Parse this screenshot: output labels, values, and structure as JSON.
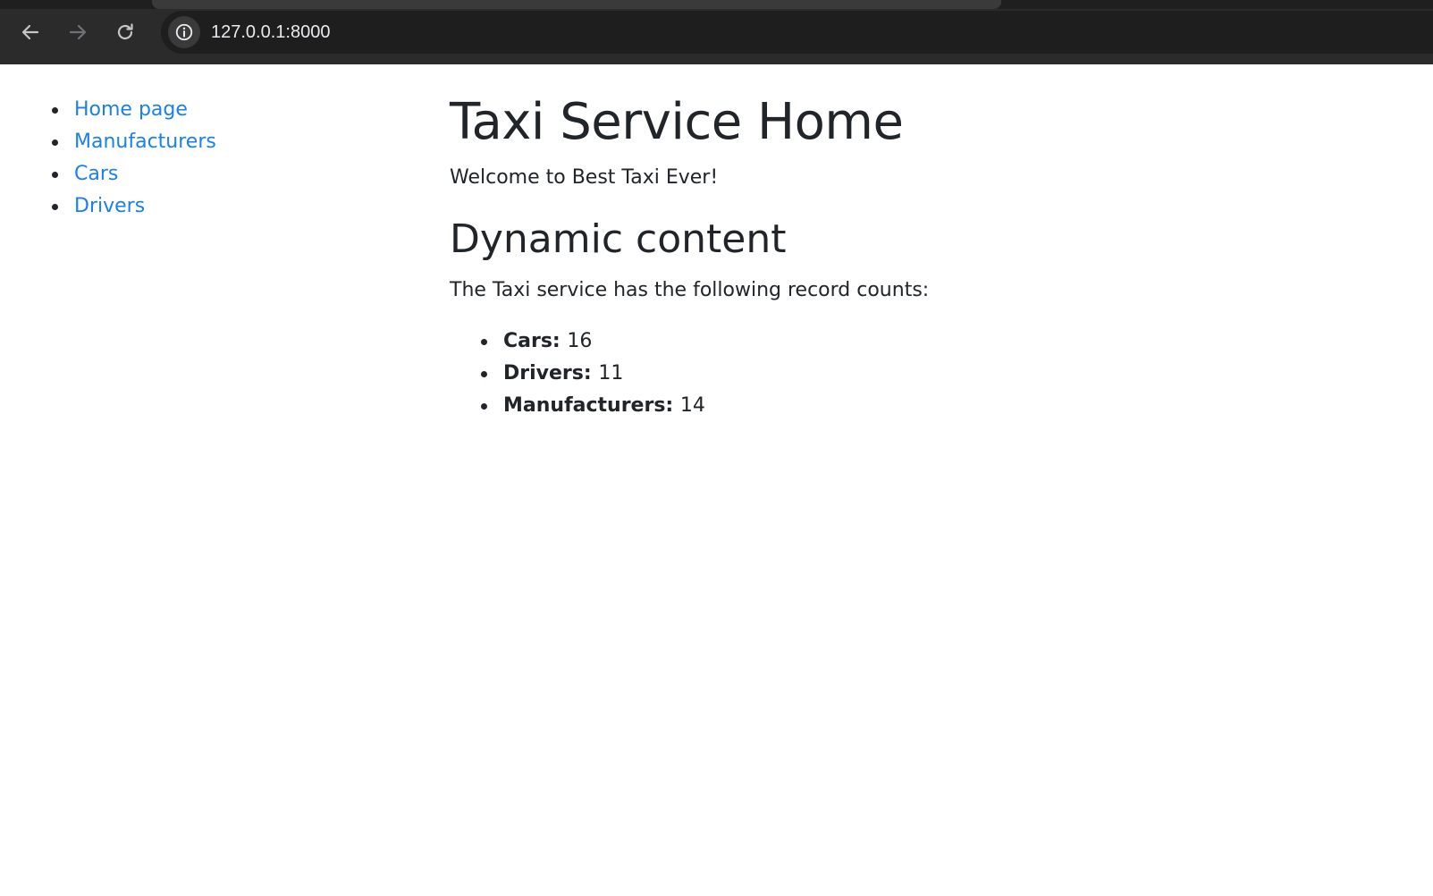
{
  "browser": {
    "url": "127.0.0.1:8000",
    "back_icon": "arrow-left-icon",
    "forward_icon": "arrow-right-icon",
    "reload_icon": "reload-icon",
    "site_info_icon": "info-icon",
    "chrome_color": "#2b2b2b",
    "omnibox_color": "#1e1e1e"
  },
  "sidebar": {
    "items": [
      {
        "label": "Home page"
      },
      {
        "label": "Manufacturers"
      },
      {
        "label": "Cars"
      },
      {
        "label": "Drivers"
      }
    ],
    "link_color": "#1a7ff0"
  },
  "main": {
    "title": "Taxi Service Home",
    "welcome": "Welcome to Best Taxi Ever!",
    "section_title": "Dynamic content",
    "counts_intro": "The Taxi service has the following record counts:",
    "counts": [
      {
        "label": "Cars:",
        "value": "16"
      },
      {
        "label": "Drivers:",
        "value": "11"
      },
      {
        "label": "Manufacturers:",
        "value": "14"
      }
    ]
  }
}
